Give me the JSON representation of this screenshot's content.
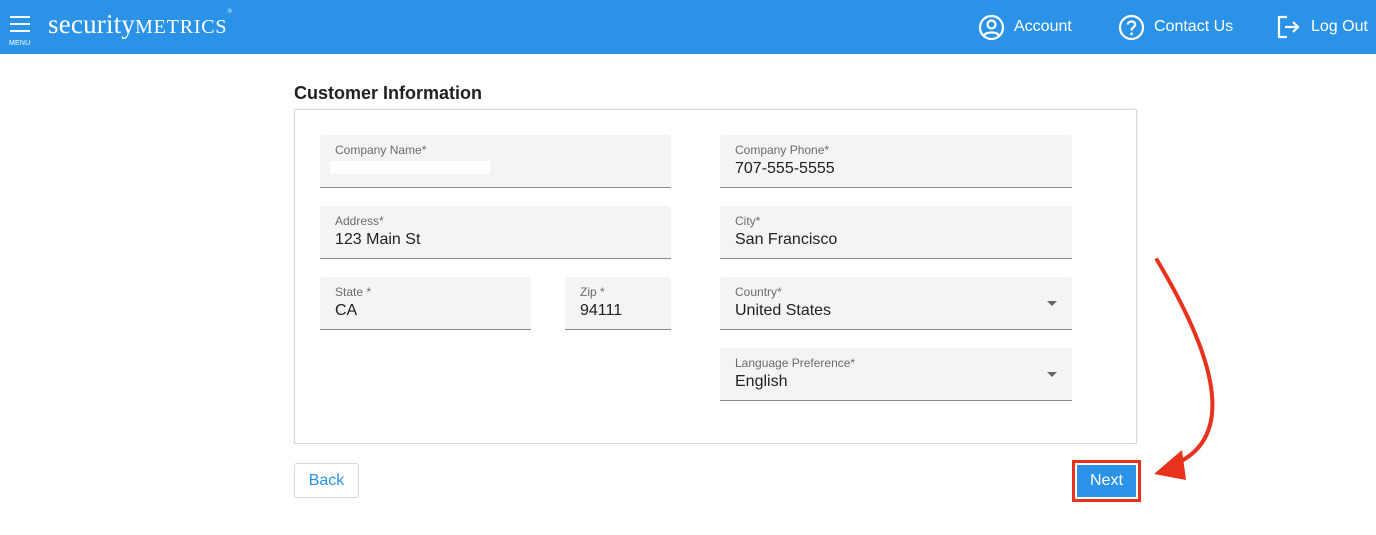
{
  "header": {
    "menu_label": "MENU",
    "logo_part1": "security",
    "logo_part2": "METRICS",
    "logo_mark": "®",
    "nav": {
      "account": "Account",
      "contact": "Contact Us",
      "logout": "Log Out"
    }
  },
  "form": {
    "title": "Customer Information",
    "fields": {
      "company_name": {
        "label": "Company Name*",
        "value": ""
      },
      "company_phone": {
        "label": "Company Phone*",
        "value": "707-555-5555"
      },
      "address": {
        "label": "Address*",
        "value": "123 Main St"
      },
      "city": {
        "label": "City*",
        "value": "San Francisco"
      },
      "state": {
        "label": "State *",
        "value": "CA"
      },
      "zip": {
        "label": "Zip *",
        "value": "94111"
      },
      "country": {
        "label": "Country*",
        "value": "United States"
      },
      "language": {
        "label": "Language Preference*",
        "value": "English"
      }
    }
  },
  "actions": {
    "back": "Back",
    "next": "Next"
  },
  "colors": {
    "brand_blue": "#2a93e8",
    "annotation_red": "#e8321e",
    "field_bg": "#f4f4f4"
  }
}
